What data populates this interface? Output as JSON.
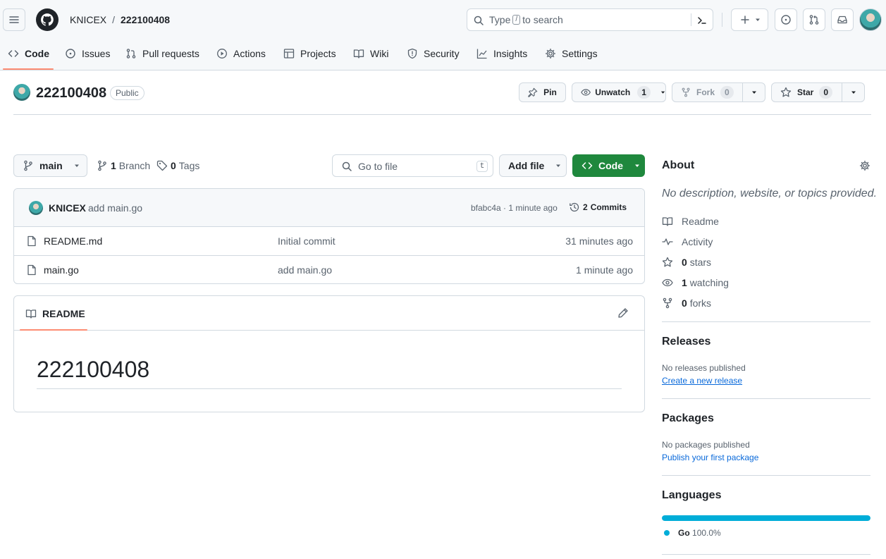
{
  "header": {
    "owner": "KNICEX",
    "separator": "/",
    "repo": "222100408",
    "search_prefix": "Type",
    "search_key": "/",
    "search_suffix": "to search"
  },
  "tabs": [
    {
      "label": "Code",
      "icon": "code-icon",
      "active": true
    },
    {
      "label": "Issues",
      "icon": "issue-icon"
    },
    {
      "label": "Pull requests",
      "icon": "pull-request-icon"
    },
    {
      "label": "Actions",
      "icon": "play-icon"
    },
    {
      "label": "Projects",
      "icon": "table-icon"
    },
    {
      "label": "Wiki",
      "icon": "book-icon"
    },
    {
      "label": "Security",
      "icon": "shield-icon"
    },
    {
      "label": "Insights",
      "icon": "graph-icon"
    },
    {
      "label": "Settings",
      "icon": "gear-icon"
    }
  ],
  "repo_header": {
    "name": "222100408",
    "visibility": "Public",
    "pin_label": "Pin",
    "unwatch_label": "Unwatch",
    "watch_count": "1",
    "fork_label": "Fork",
    "fork_count": "0",
    "star_label": "Star",
    "star_count": "0"
  },
  "file_nav": {
    "branch": "main",
    "branch_count": "1",
    "branch_label": "Branch",
    "tag_count": "0",
    "tag_label": "Tags",
    "go_to_file_placeholder": "Go to file",
    "go_to_file_key": "t",
    "add_file_label": "Add file",
    "code_label": "Code"
  },
  "latest_commit": {
    "author": "KNICEX",
    "message": "add main.go",
    "sha_time": "bfabc4a · 1 minute ago",
    "commits_count": "2",
    "commits_label": "Commits"
  },
  "files": [
    {
      "name": "README.md",
      "message": "Initial commit",
      "time": "31 minutes ago"
    },
    {
      "name": "main.go",
      "message": "add main.go",
      "time": "1 minute ago"
    }
  ],
  "readme": {
    "tab_label": "README",
    "heading": "222100408"
  },
  "about": {
    "title": "About",
    "description": "No description, website, or topics provided.",
    "readme_label": "Readme",
    "activity_label": "Activity",
    "stars_count": "0",
    "stars_label": "stars",
    "watching_count": "1",
    "watching_label": "watching",
    "forks_count": "0",
    "forks_label": "forks"
  },
  "releases": {
    "title": "Releases",
    "empty_text": "No releases published",
    "create_link": "Create a new release"
  },
  "packages": {
    "title": "Packages",
    "empty_text": "No packages published",
    "publish_link": "Publish your first package"
  },
  "languages": {
    "title": "Languages",
    "items": [
      {
        "name": "Go",
        "percent": "100.0%",
        "fraction": 1.0,
        "color": "#00add8"
      }
    ]
  },
  "colors": {
    "accent": "#fd8c73",
    "code_button": "#1f883d",
    "link": "#0969da"
  }
}
